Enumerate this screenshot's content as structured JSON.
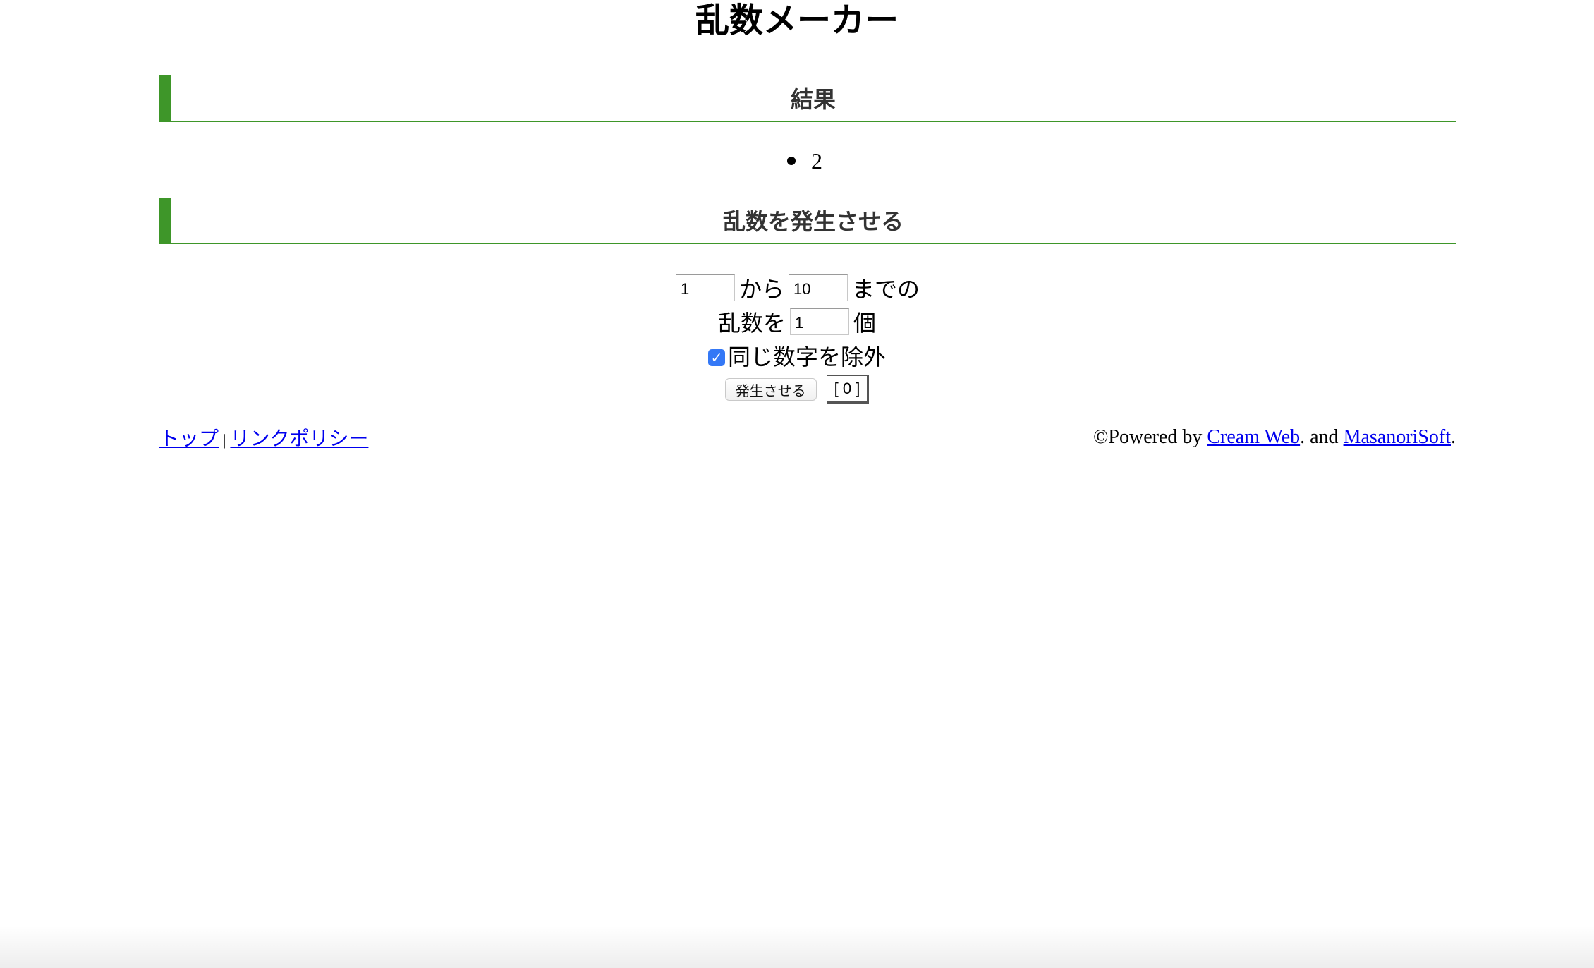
{
  "title": "乱数メーカー",
  "result": {
    "heading": "結果",
    "items": [
      "2"
    ]
  },
  "generate": {
    "heading": "乱数を発生させる",
    "from_value": "1",
    "from_label": "から",
    "to_value": "10",
    "to_label": "までの",
    "count_prefix": "乱数を",
    "count_value": "1",
    "count_suffix": "個",
    "exclude_checked": true,
    "exclude_label": "同じ数字を除外",
    "generate_button": "発生させる",
    "counter_button": "[ 0 ]"
  },
  "footer": {
    "link_top": "トップ",
    "separator": "|",
    "link_policy": "リンクポリシー",
    "powered_prefix": "©Powered by ",
    "link_cream": "Cream Web",
    "and_text": ". and ",
    "link_masanori": "MasanoriSoft",
    "suffix": "."
  },
  "colors": {
    "accent_green": "#3e9629",
    "link_blue": "#0000ee",
    "checkbox_blue": "#3478f6"
  },
  "icons": {
    "checkbox": "checkmark-icon",
    "bullet": "bullet-dot-icon"
  }
}
